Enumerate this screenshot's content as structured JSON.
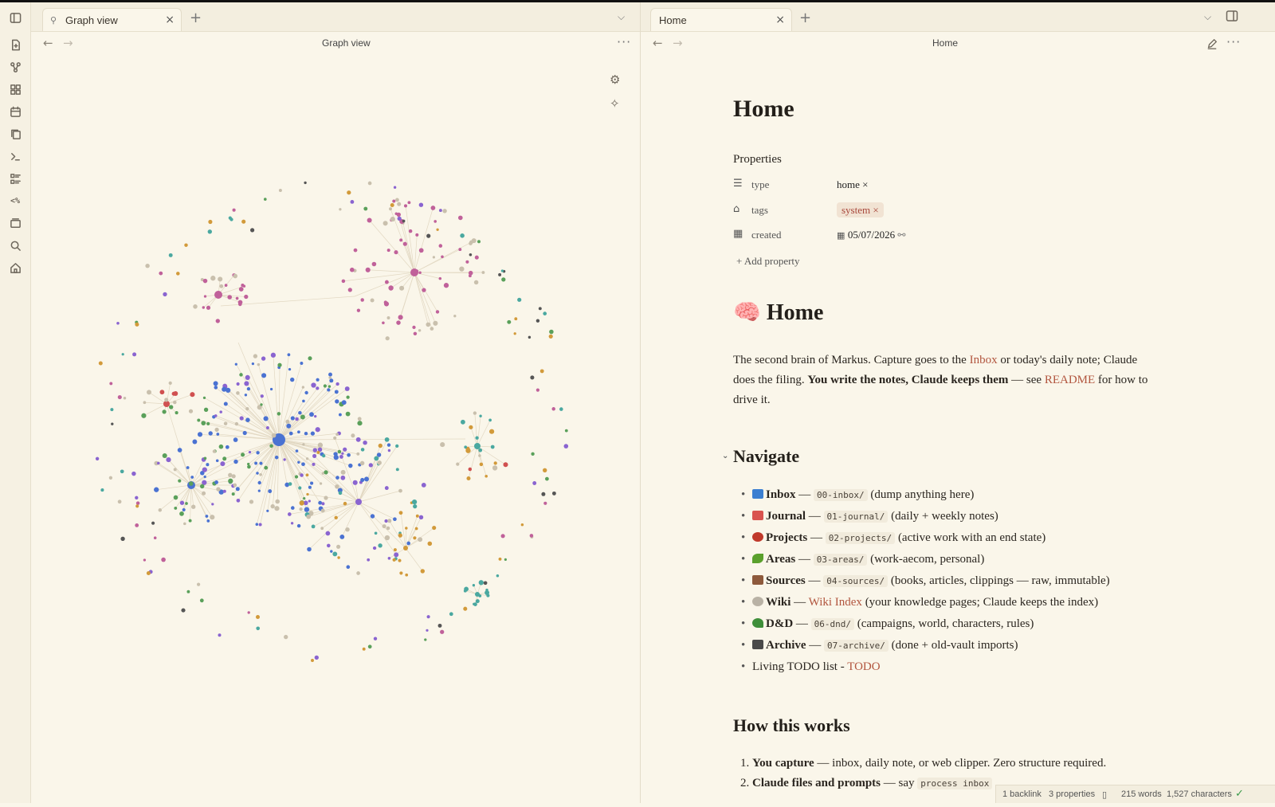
{
  "colors": {
    "background": "#faf6ea",
    "link": "#b2563f",
    "tag_bg": "#f1e3d3",
    "tag_fg": "#a8473b"
  },
  "ribbon": {
    "icons": [
      "sidebar-toggle-icon",
      "new-note-icon",
      "graph-icon",
      "canvas-icon",
      "calendar-icon",
      "copy-icon",
      "terminal-icon",
      "list-icon",
      "templater-icon",
      "slides-icon",
      "search-icon",
      "home-icon"
    ],
    "templater_text": "<%"
  },
  "left_pane": {
    "tab": {
      "label": "Graph view",
      "icon": "graph-icon",
      "close": "×"
    },
    "new_tab": "+",
    "chevron": "⌵",
    "header_title": "Graph view",
    "back": "←",
    "forward": "→",
    "more": "···",
    "graph_controls": [
      "settings-icon",
      "animate-icon"
    ]
  },
  "right_pane": {
    "tab": {
      "label": "Home",
      "close": "×"
    },
    "new_tab": "+",
    "header_title": "Home",
    "back": "←",
    "forward": "→",
    "more": "···"
  },
  "doc": {
    "title": "Home",
    "properties_heading": "Properties",
    "properties": [
      {
        "icon": "list-icon",
        "key": "type",
        "value": "home ×"
      },
      {
        "icon": "tag-icon",
        "key": "tags",
        "value": "system ×"
      },
      {
        "icon": "calendar-icon",
        "key": "created",
        "value": "05/07/2026"
      }
    ],
    "add_property": "+ Add property",
    "heading": "🧠 Home",
    "intro": {
      "p1": "The second brain of Markus. Capture goes to the ",
      "inbox_link": "Inbox",
      "p2": " or today's daily note; Claude does the filing. ",
      "bold": "You write the notes, Claude keeps them",
      "p3": " — see ",
      "readme_link": "README",
      "p4": " for how to drive it."
    },
    "navigate_heading": "Navigate",
    "nav": [
      {
        "emoji_color": "#3b7fd1",
        "name": "Inbox",
        "sep": " — ",
        "code": "00-inbox/",
        "desc": " (dump anything here)"
      },
      {
        "emoji_color": "#d9534f",
        "name": "Journal",
        "sep": " — ",
        "code": "01-journal/",
        "desc": " (daily + weekly notes)"
      },
      {
        "emoji_color": "#c0392b",
        "name": "Projects",
        "sep": " — ",
        "code": "02-projects/",
        "desc": " (active work with an end state)"
      },
      {
        "emoji_color": "#5aa02c",
        "name": "Areas",
        "sep": " — ",
        "code": "03-areas/",
        "desc": " (work-aecom, personal)"
      },
      {
        "emoji_color": "#8e5a3c",
        "name": "Sources",
        "sep": " — ",
        "code": "04-sources/",
        "desc": " (books, articles, clippings — raw, immutable)"
      },
      {
        "emoji_color": "#b9b2a5",
        "name": "Wiki",
        "sep": " — ",
        "link": "Wiki Index",
        "desc": " (your knowledge pages; Claude keeps the index)"
      },
      {
        "emoji_color": "#3f8f3a",
        "name": "D&D",
        "sep": " — ",
        "code": "06-dnd/",
        "desc": " (campaigns, world, characters, rules)"
      },
      {
        "emoji_color": "#4a4a4a",
        "name": "Archive",
        "sep": " — ",
        "code": "07-archive/",
        "desc": " (done + old-vault imports)"
      }
    ],
    "todo": {
      "text": "Living TODO list - ",
      "link": "TODO"
    },
    "how_heading": "How this works",
    "how": [
      {
        "bold": "You capture",
        "rest": " — inbox, daily note, or web clipper. Zero structure required."
      },
      {
        "bold": "Claude files and prompts",
        "rest": " — say ",
        "code": "process inbox"
      }
    ]
  },
  "status": {
    "backlinks": "1 backlink",
    "properties": "3 properties",
    "words": "215 words",
    "characters": "1,527 characters"
  }
}
